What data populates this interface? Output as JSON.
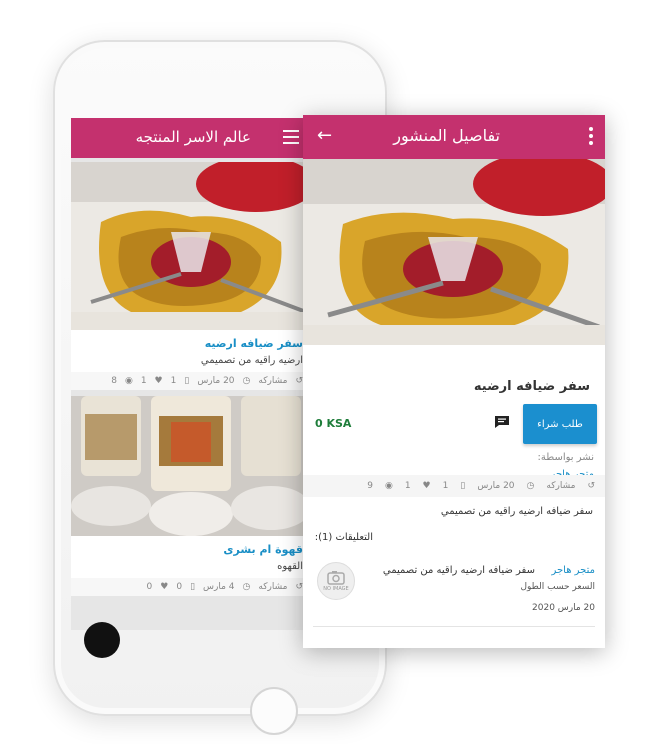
{
  "colors": {
    "brand": "#c4316e",
    "link": "#1a8fc6",
    "button": "#1b8fcf",
    "price": "#1e7d3a"
  },
  "list_screen": {
    "title": "عالم الاسر المنتجه",
    "posts": [
      {
        "title": "سفر ضيافه ارضيه",
        "description": "ارضيه راقيه من تصميمي",
        "share_label": "مشاركه",
        "date": "20 مارس",
        "comments": "1",
        "likes": "1",
        "views": "8"
      },
      {
        "title": "قهوة ام بشرى",
        "description": "القهوه",
        "share_label": "مشاركه",
        "date": "4 مارس",
        "comments": "0",
        "likes": "0",
        "views": ""
      }
    ]
  },
  "detail_screen": {
    "title": "تفاصيل المنشور",
    "post_title": "سفر ضيافه ارضيه",
    "buy_button": "طلب شراء",
    "price": "0  KSA",
    "posted_by_label": "نشر بواسطة:",
    "store_name": "متجر هاجر",
    "stats": {
      "share_label": "مشاركه",
      "date": "20 مارس",
      "comments": "1",
      "likes": "1",
      "views": "9"
    },
    "description": "سفر ضيافه ارضيه راقيه من تصميمي",
    "comments_heading": "التعليقات (1):",
    "comment": {
      "author": "متجر هاجر",
      "text": "سفر ضيافه ارضيه راقيه من تصميمي",
      "subtext": "السعر حسب الطول",
      "date": "20 مارس 2020",
      "avatar_label": "NO IMAGE"
    }
  }
}
